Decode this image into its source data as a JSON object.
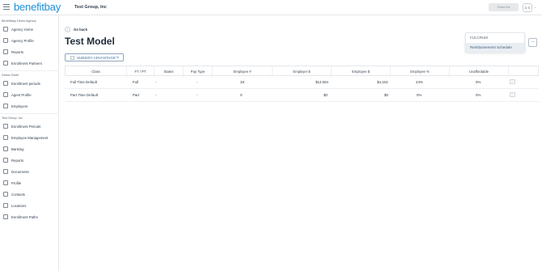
{
  "header": {
    "logo": "benefitbay",
    "company": "Test Group, Inc",
    "top_button": "Select Ent",
    "avatar_initials": "D S"
  },
  "sidebar": {
    "sections": [
      {
        "title": "Benefitbay Demo Agency",
        "items": [
          {
            "label": "Agency Home",
            "icon": "home-icon"
          },
          {
            "label": "Agency Profile",
            "icon": "profile-icon"
          },
          {
            "label": "Reports",
            "icon": "reports-icon"
          },
          {
            "label": "Enrollment Partners",
            "icon": "partners-icon"
          }
        ]
      },
      {
        "title": "Debra Smith",
        "items": [
          {
            "label": "Enrollment periods",
            "icon": "calendar-icon"
          },
          {
            "label": "Agent Profile",
            "icon": "agent-icon"
          },
          {
            "label": "Employers",
            "icon": "employers-icon"
          }
        ]
      },
      {
        "title": "Test Group, Inc",
        "items": [
          {
            "label": "Enrollment Periods",
            "icon": "calendar-icon"
          },
          {
            "label": "Employee Management",
            "icon": "people-icon"
          },
          {
            "label": "Banking",
            "icon": "bank-icon"
          },
          {
            "label": "Reports",
            "icon": "reports-icon"
          },
          {
            "label": "Documents",
            "icon": "document-icon"
          },
          {
            "label": "Profile",
            "icon": "profile-icon"
          },
          {
            "label": "Contacts",
            "icon": "contacts-icon"
          },
          {
            "label": "Locations",
            "icon": "location-icon"
          },
          {
            "label": "Enrollment Paths",
            "icon": "paths-icon"
          }
        ]
      }
    ]
  },
  "main": {
    "back_label": "Go back",
    "title": "Test Model",
    "subsidy_label": "SUBSIDY ADVANTAGE™",
    "dropdown": [
      "FULCRUM",
      "Reimbursement Schedule"
    ],
    "table": {
      "headers": [
        "Class",
        "FT / PT",
        "States",
        "Pay Type",
        "Employee #",
        "Employer $",
        "Employee $",
        "Employee %",
        "Unaffordable"
      ],
      "rows": [
        [
          "Full Time Default",
          "Full",
          "-",
          "-",
          "28",
          "$12,904",
          "$4,153",
          "24%",
          "0%"
        ],
        [
          "Part Time Default",
          "Part",
          "-",
          "-",
          "0",
          "$0",
          "$0",
          "0%",
          "0%"
        ]
      ]
    }
  },
  "colors": {
    "brand": "#1d8fd6",
    "accent": "#3a6ea5"
  }
}
